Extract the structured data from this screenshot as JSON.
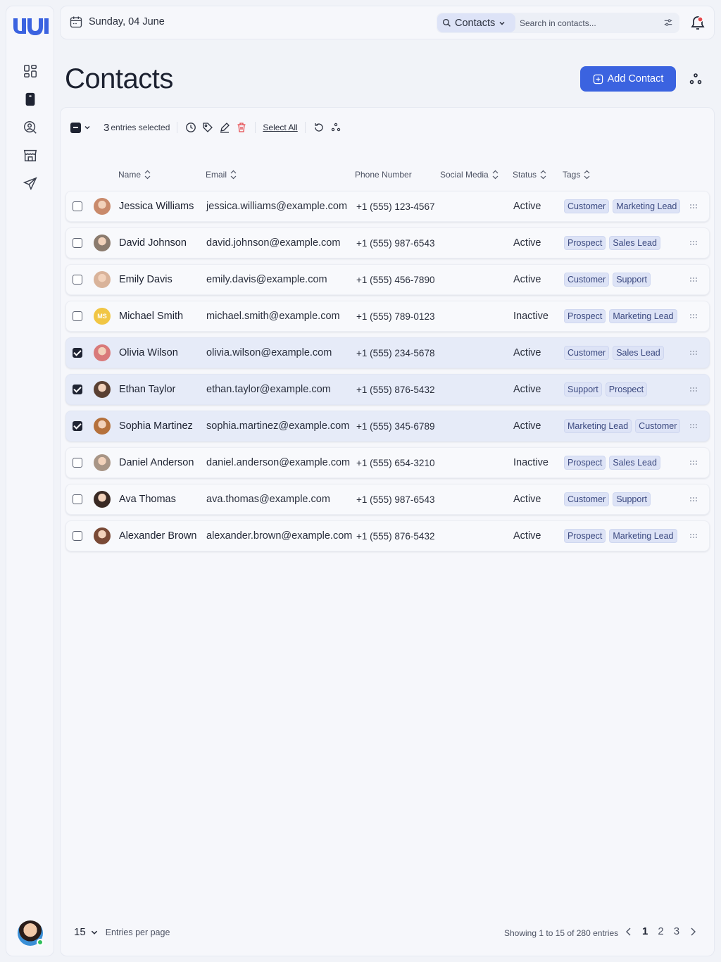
{
  "sidebar": {
    "logo": "logo-icon",
    "items": [
      {
        "icon": "dashboard-icon"
      },
      {
        "icon": "contacts-icon"
      },
      {
        "icon": "search-user-icon"
      },
      {
        "icon": "store-icon"
      },
      {
        "icon": "send-icon"
      }
    ],
    "avatar_status": "online"
  },
  "topbar": {
    "date": "Sunday, 04 June",
    "search_scope": "Contacts",
    "search_placeholder": "Search in contacts...",
    "notification_badge_color": "#e5484d"
  },
  "page": {
    "title": "Contacts",
    "add_button": "Add Contact"
  },
  "bulk": {
    "selected_count": "3",
    "selected_label": "entries selected",
    "select_all": "Select All"
  },
  "columns": {
    "name": "Name",
    "email": "Email",
    "phone": "Phone Number",
    "social": "Social Media",
    "status": "Status",
    "tags": "Tags"
  },
  "contacts": [
    {
      "name": "Jessica Williams",
      "email": "jessica.williams@example.com",
      "phone": "+1 (555) 123-4567",
      "status": "Active",
      "tags": [
        "Customer",
        "Marketing Lead"
      ],
      "selected": false
    },
    {
      "name": "David Johnson",
      "email": "david.johnson@example.com",
      "phone": "+1 (555) 987-6543",
      "status": "Active",
      "tags": [
        "Prospect",
        "Sales Lead"
      ],
      "selected": false
    },
    {
      "name": "Emily Davis",
      "email": "emily.davis@example.com",
      "phone": "+1 (555) 456-7890",
      "status": "Active",
      "tags": [
        "Customer",
        "Support"
      ],
      "selected": false
    },
    {
      "name": "Michael Smith",
      "email": "michael.smith@example.com",
      "phone": "+1 (555) 789-0123",
      "status": "Inactive",
      "tags": [
        "Prospect",
        "Marketing Lead"
      ],
      "selected": false,
      "initials": "MS"
    },
    {
      "name": "Olivia Wilson",
      "email": "olivia.wilson@example.com",
      "phone": "+1 (555) 234-5678",
      "status": "Active",
      "tags": [
        "Customer",
        "Sales Lead"
      ],
      "selected": true
    },
    {
      "name": "Ethan Taylor",
      "email": "ethan.taylor@example.com",
      "phone": "+1 (555) 876-5432",
      "status": "Active",
      "tags": [
        "Support",
        "Prospect"
      ],
      "selected": true
    },
    {
      "name": "Sophia Martinez",
      "email": "sophia.martinez@example.com",
      "phone": "+1 (555) 345-6789",
      "status": "Active",
      "tags": [
        "Marketing Lead",
        "Customer"
      ],
      "selected": true
    },
    {
      "name": "Daniel Anderson",
      "email": "daniel.anderson@example.com",
      "phone": "+1 (555) 654-3210",
      "status": "Inactive",
      "tags": [
        "Prospect",
        "Sales Lead"
      ],
      "selected": false
    },
    {
      "name": "Ava Thomas",
      "email": "ava.thomas@example.com",
      "phone": "+1 (555) 987-6543",
      "status": "Active",
      "tags": [
        "Customer",
        "Support"
      ],
      "selected": false
    },
    {
      "name": "Alexander Brown",
      "email": "alexander.brown@example.com",
      "phone": "+1 (555) 876-5432",
      "status": "Active",
      "tags": [
        "Prospect",
        "Marketing Lead"
      ],
      "selected": false
    }
  ],
  "footer": {
    "per_page": "15",
    "per_page_label": "Entries per page",
    "showing": "Showing 1 to 15 of 280 entries",
    "pages": [
      "1",
      "2",
      "3"
    ],
    "current_page": "1"
  },
  "colors": {
    "accent": "#3b63e0",
    "tag_bg": "#dde3f6",
    "selected_row": "#e6ebf8"
  }
}
